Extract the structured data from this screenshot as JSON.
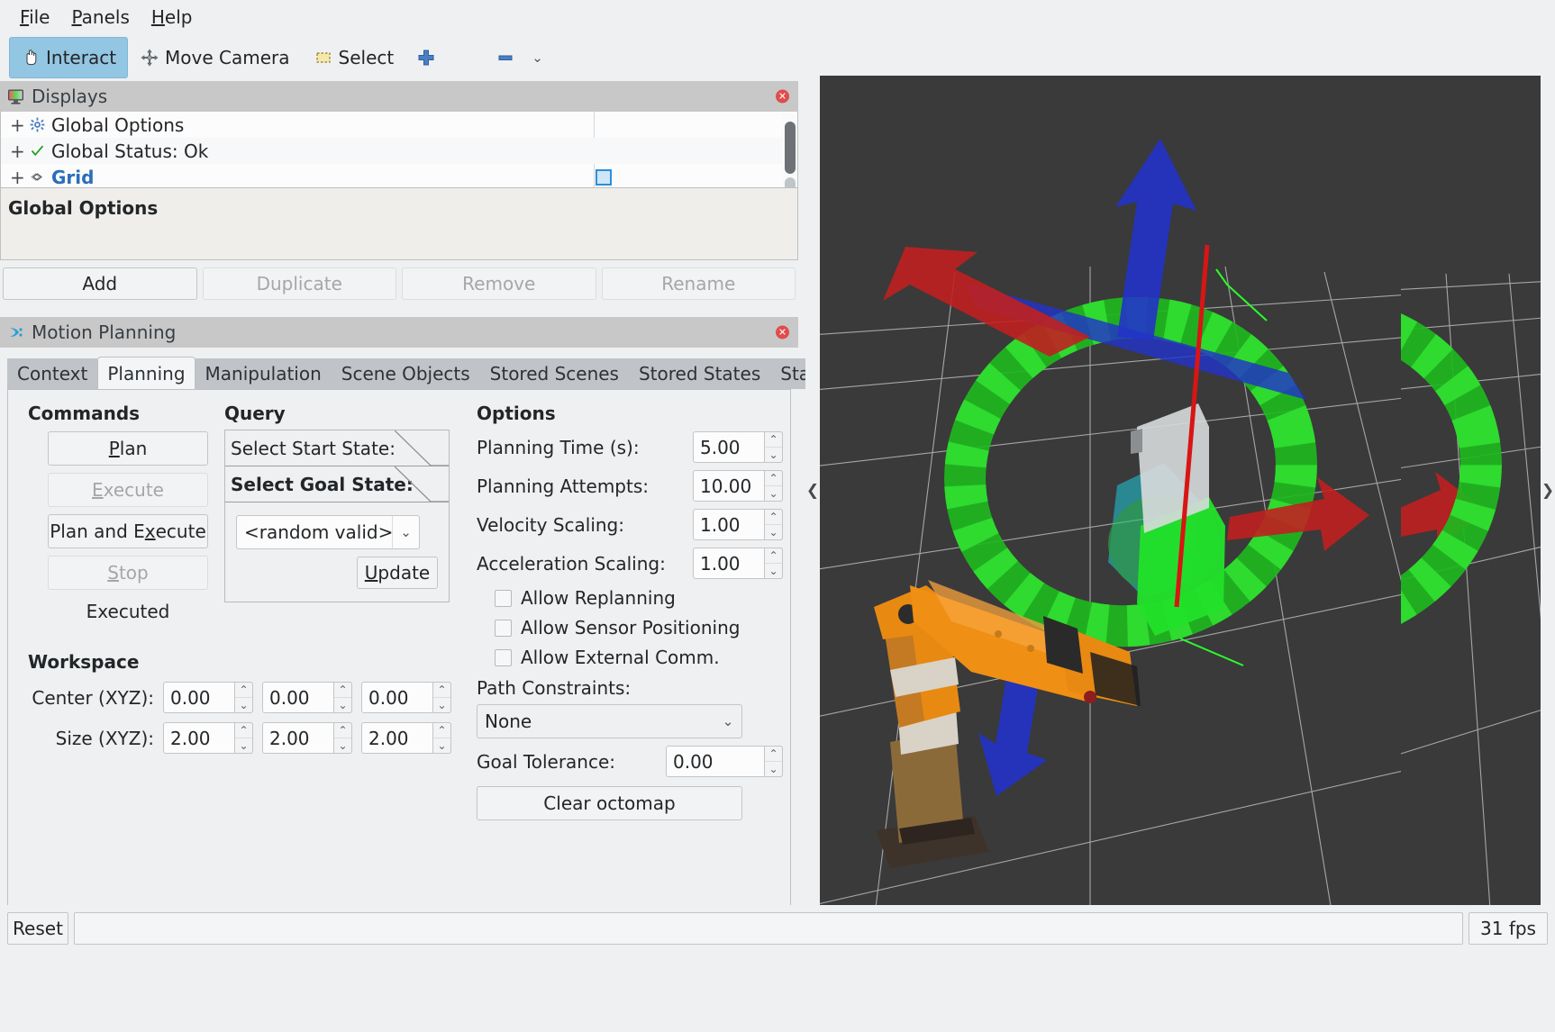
{
  "menubar": {
    "items": [
      {
        "label": "File",
        "mnemonic": "F"
      },
      {
        "label": "Panels",
        "mnemonic": "P"
      },
      {
        "label": "Help",
        "mnemonic": "H"
      }
    ]
  },
  "toolbar": {
    "interact_label": "Interact",
    "move_camera_label": "Move Camera",
    "select_label": "Select",
    "add_tool_icon": "plus-icon",
    "remove_tool_icon": "minus-icon",
    "overflow_icon": "chevron-down-icon"
  },
  "displays": {
    "title": "Displays",
    "title_icon": "monitor-icon",
    "close_icon": "close-icon",
    "tree": [
      {
        "expander": "+",
        "icon": "gear-icon",
        "label": "Global Options",
        "has_swatch": false
      },
      {
        "expander": "+",
        "icon": "check-icon",
        "label": "Global Status: Ok",
        "has_swatch": false
      },
      {
        "expander": "+",
        "icon": "grid-icon",
        "label": "Grid",
        "has_swatch": true
      }
    ],
    "properties_title": "Global Options",
    "buttons": [
      {
        "label": "Add",
        "enabled": true
      },
      {
        "label": "Duplicate",
        "enabled": false
      },
      {
        "label": "Remove",
        "enabled": false
      },
      {
        "label": "Rename",
        "enabled": false
      }
    ]
  },
  "motion_planning": {
    "title": "Motion Planning",
    "title_icon": "moveit-icon",
    "close_icon": "close-icon",
    "tabs": [
      {
        "label": "Context",
        "selected": false
      },
      {
        "label": "Planning",
        "selected": true
      },
      {
        "label": "Manipulation",
        "selected": false
      },
      {
        "label": "Scene Objects",
        "selected": false
      },
      {
        "label": "Stored Scenes",
        "selected": false
      },
      {
        "label": "Stored States",
        "selected": false
      },
      {
        "label": "Status",
        "selected": false
      }
    ],
    "commands": {
      "heading": "Commands",
      "plan": "Plan",
      "plan_mnemonic": "P",
      "execute": "Execute",
      "execute_mnemonic": "E",
      "plan_and_execute": "Plan and Execute",
      "plan_and_execute_mnemonic": "x",
      "stop": "Stop",
      "stop_mnemonic": "S",
      "status": "Executed"
    },
    "query": {
      "heading": "Query",
      "start_state_label": "Select Start State:",
      "goal_state_label": "Select Goal State:",
      "goal_state_value": "<random valid>",
      "update_label": "Update",
      "update_mnemonic": "U"
    },
    "workspace": {
      "heading": "Workspace",
      "center_label": "Center (XYZ):",
      "center_values": [
        "0.00",
        "0.00",
        "0.00"
      ],
      "size_label": "Size (XYZ):",
      "size_values": [
        "2.00",
        "2.00",
        "2.00"
      ]
    },
    "options": {
      "heading": "Options",
      "planning_time_label": "Planning Time (s):",
      "planning_time_value": "5.00",
      "planning_attempts_label": "Planning Attempts:",
      "planning_attempts_value": "10.00",
      "velocity_scaling_label": "Velocity Scaling:",
      "velocity_scaling_value": "1.00",
      "acceleration_scaling_label": "Acceleration Scaling:",
      "acceleration_scaling_value": "1.00",
      "allow_replanning_label": "Allow Replanning",
      "allow_replanning_checked": false,
      "allow_sensor_positioning_label": "Allow Sensor Positioning",
      "allow_sensor_positioning_checked": false,
      "allow_external_comm_label": "Allow External Comm.",
      "allow_external_comm_checked": false,
      "path_constraints_label": "Path Constraints:",
      "path_constraints_value": "None",
      "goal_tolerance_label": "Goal Tolerance:",
      "goal_tolerance_value": "0.00",
      "clear_octomap_label": "Clear octomap"
    }
  },
  "viewport": {
    "collapse_left_icon": "chevron-left-icon",
    "collapse_right_icon": "chevron-right-icon",
    "background_color": "#3a3a3a",
    "grid_color": "#b8b8b8",
    "robot_color": "#f08010",
    "marker_ring_color": "#22cc22",
    "axis_x_color": "#cc2222",
    "axis_y_color": "#22cc22",
    "axis_z_color": "#2222cc"
  },
  "statusbar": {
    "reset_label": "Reset",
    "message": "",
    "fps": "31 fps"
  }
}
